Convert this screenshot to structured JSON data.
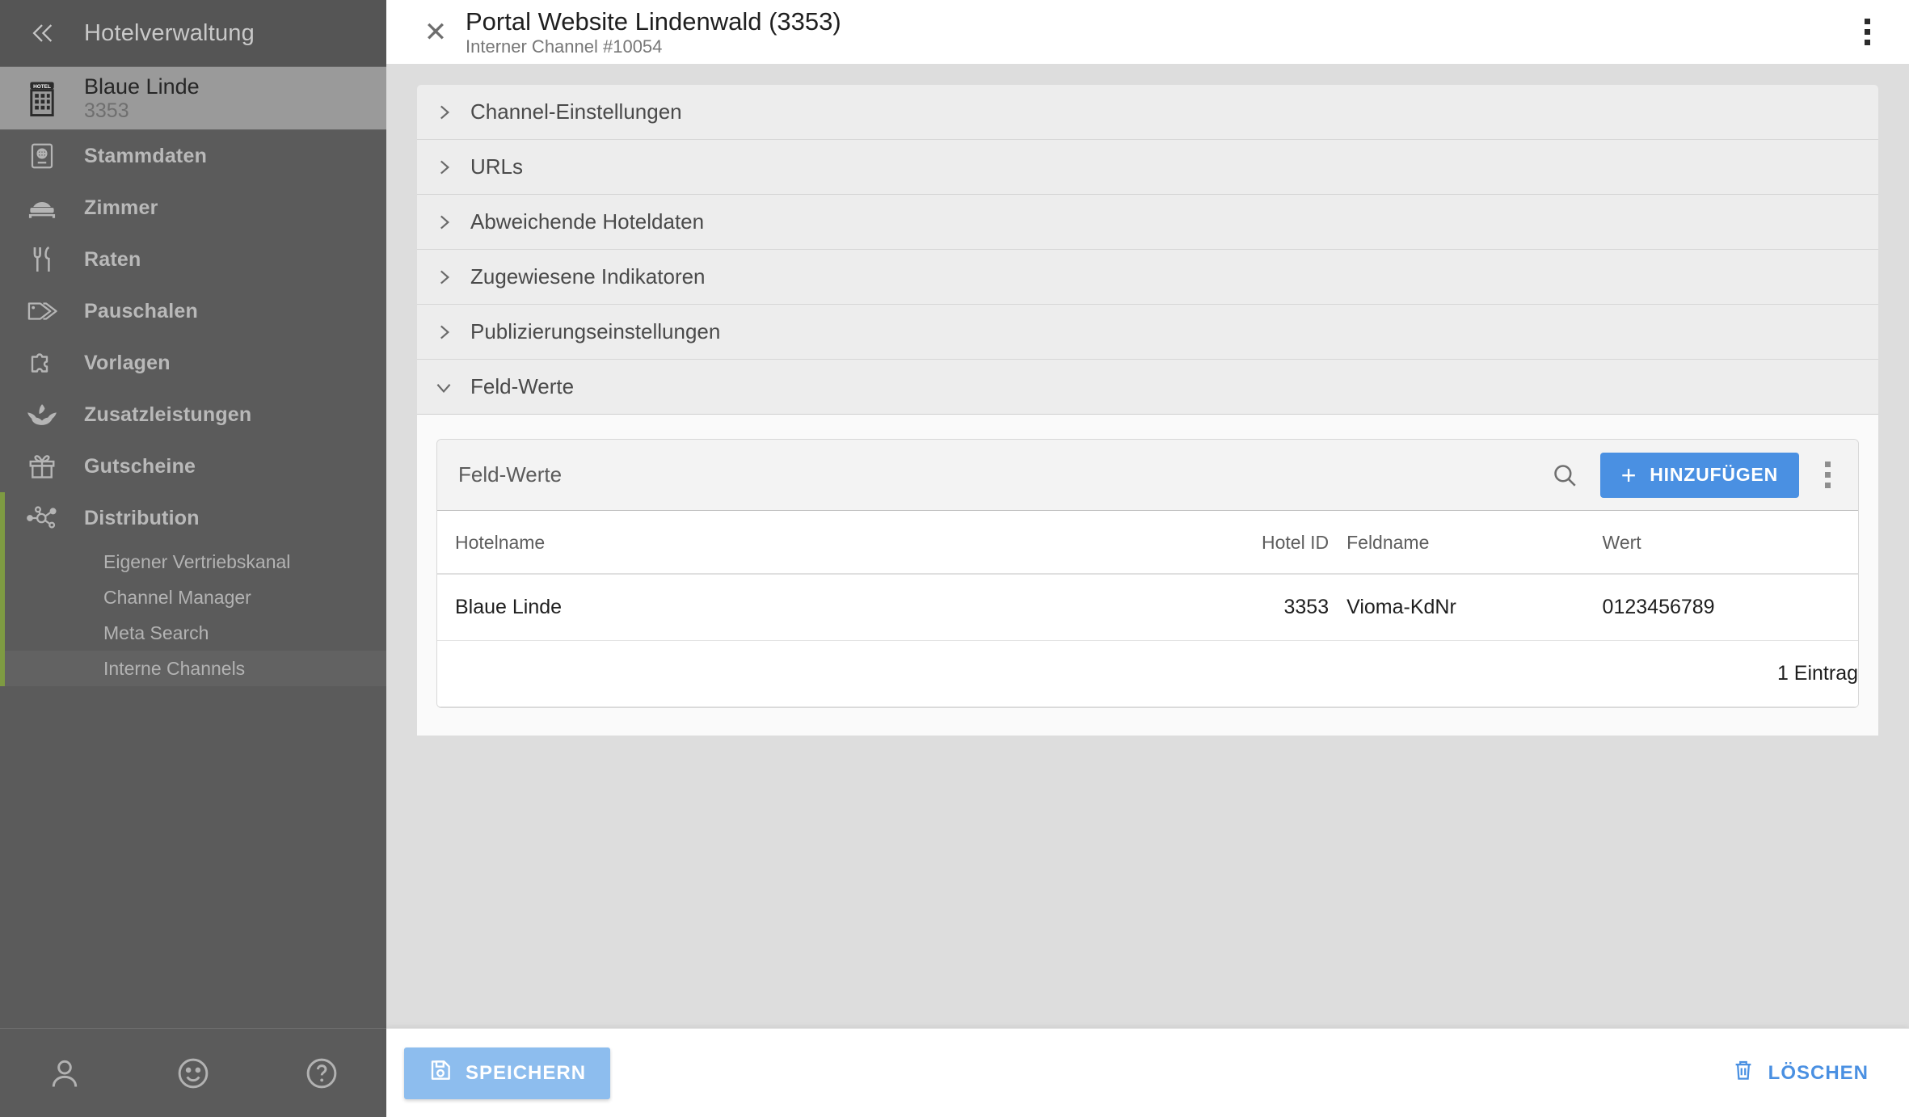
{
  "sidebar": {
    "title": "Hotelverwaltung",
    "collapse_icon": "chevron-double-left-icon",
    "hotel": {
      "name": "Blaue Linde",
      "id": "3353",
      "icon": "hotel-building-icon"
    },
    "items": [
      {
        "label": "Stammdaten",
        "icon": "passport-globe-icon"
      },
      {
        "label": "Zimmer",
        "icon": "bed-icon"
      },
      {
        "label": "Raten",
        "icon": "cutlery-icon"
      },
      {
        "label": "Pauschalen",
        "icon": "price-tag-icon"
      },
      {
        "label": "Vorlagen",
        "icon": "puzzle-piece-icon"
      },
      {
        "label": "Zusatzleistungen",
        "icon": "lotus-icon"
      },
      {
        "label": "Gutscheine",
        "icon": "gift-icon"
      },
      {
        "label": "Distribution",
        "icon": "network-nodes-icon"
      }
    ],
    "distribution_subitems": [
      {
        "label": "Eigener Vertriebskanal",
        "selected": false
      },
      {
        "label": "Channel Manager",
        "selected": false
      },
      {
        "label": "Meta Search",
        "selected": false
      },
      {
        "label": "Interne Channels",
        "selected": true
      }
    ],
    "bottom_icons": [
      {
        "name": "user-icon"
      },
      {
        "name": "smiley-icon"
      },
      {
        "name": "help-circle-icon"
      }
    ],
    "accent_color": "#7e9b42"
  },
  "panel": {
    "close_icon": "close-icon",
    "title": "Portal Website Lindenwald (3353)",
    "subtitle": "Interner Channel #10054",
    "kebab_icon": "kebab-menu-icon",
    "accordion": [
      {
        "label": "Channel-Einstellungen",
        "open": false
      },
      {
        "label": "URLs",
        "open": false
      },
      {
        "label": "Abweichende Hoteldaten",
        "open": false
      },
      {
        "label": "Zugewiesene Indikatoren",
        "open": false
      },
      {
        "label": "Publizierungseinstellungen",
        "open": false
      },
      {
        "label": "Feld-Werte",
        "open": true
      }
    ],
    "field_values": {
      "toolbar_title": "Feld-Werte",
      "search_icon": "search-icon",
      "add_label": "HINZUFÜGEN",
      "add_icon": "plus-icon",
      "kebab_icon": "kebab-menu-icon",
      "add_button_color": "#4a90e2",
      "columns": [
        "Hotelname",
        "Hotel ID",
        "Feldname",
        "Wert"
      ],
      "rows": [
        {
          "hotelname": "Blaue Linde",
          "hotel_id": "3353",
          "feldname": "Vioma-KdNr",
          "wert": "0123456789"
        }
      ],
      "count_label": "1 Eintrag"
    },
    "footer": {
      "save_label": "SPEICHERN",
      "save_icon": "save-disk-icon",
      "delete_label": "LÖSCHEN",
      "delete_icon": "trash-icon"
    }
  }
}
